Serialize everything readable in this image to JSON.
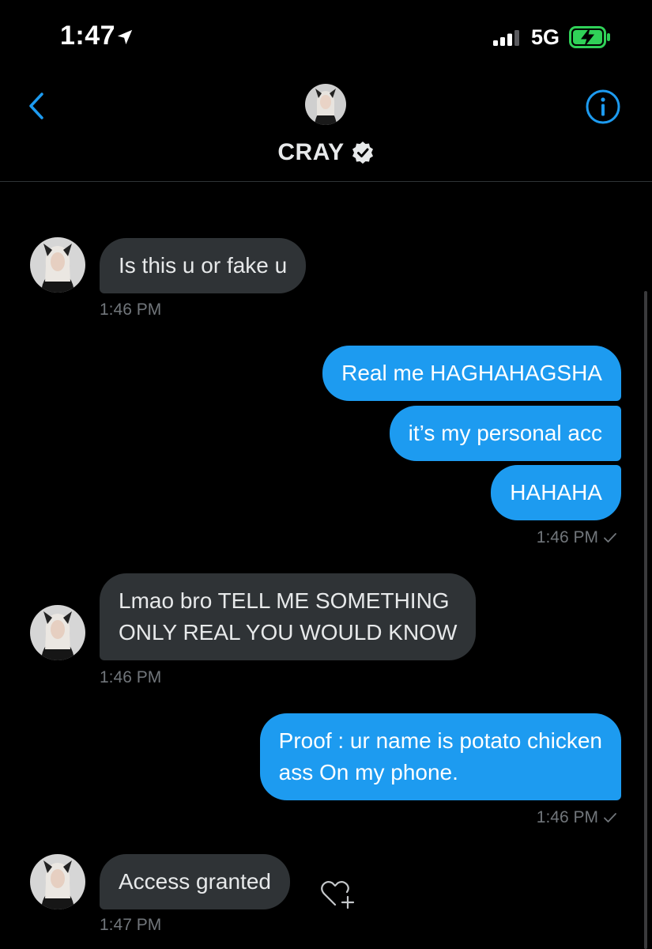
{
  "status_bar": {
    "time": "1:47",
    "network": "5G",
    "icons": [
      "location-arrow-icon",
      "signal-bars-icon",
      "battery-charging-icon"
    ]
  },
  "header": {
    "name": "CRAY",
    "verified": true,
    "icons": [
      "back-chevron-icon",
      "verified-badge-icon",
      "info-icon"
    ]
  },
  "colors": {
    "background": "#000000",
    "received_bubble": "#2f3336",
    "sent_bubble": "#1d9bf0",
    "accent": "#1d9bf0",
    "timestamp": "#71767b",
    "battery": "#30d158"
  },
  "messages": [
    {
      "direction": "received",
      "lines": [
        "Is this u or fake u"
      ]
    },
    {
      "direction": "sent",
      "lines": [
        "Real me HAGHAHAGSHA"
      ]
    },
    {
      "direction": "sent",
      "lines": [
        "it’s my personal acc"
      ]
    },
    {
      "direction": "sent",
      "lines": [
        "HAHAHA"
      ]
    },
    {
      "direction": "received",
      "lines": [
        "Lmao bro TELL ME SOMETHING",
        "ONLY REAL YOU WOULD KNOW"
      ]
    },
    {
      "direction": "sent",
      "lines": [
        "Proof : ur name is potato chicken",
        "ass On my phone."
      ]
    },
    {
      "direction": "received",
      "lines": [
        "Access granted"
      ]
    }
  ],
  "timestamps": [
    "1:46 PM",
    "1:46 PM",
    "1:46 PM",
    "1:46 PM",
    "1:47 PM"
  ]
}
